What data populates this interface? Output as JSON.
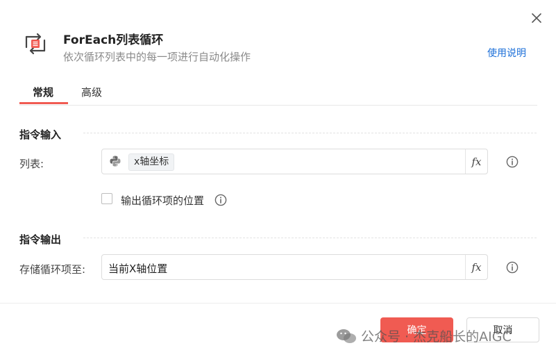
{
  "header": {
    "title": "ForEach列表循环",
    "subtitle": "依次循环列表中的每一项进行自动化操作",
    "help_link": "使用说明"
  },
  "tabs": [
    {
      "label": "常规",
      "active": true
    },
    {
      "label": "高级",
      "active": false
    }
  ],
  "input_section": {
    "title": "指令输入",
    "list_field": {
      "label": "列表:",
      "value_chip": "x轴坐标",
      "fx_label": "fx"
    },
    "output_index_checkbox": {
      "label": "输出循环项的位置",
      "checked": false
    }
  },
  "output_section": {
    "title": "指令输出",
    "store_field": {
      "label": "存储循环项至:",
      "value": "当前X轴位置",
      "fx_label": "fx"
    }
  },
  "footer": {
    "confirm_label": "确定",
    "cancel_label": "取消"
  },
  "watermark": {
    "text": "公众号 · 杰克船长的AIGC"
  },
  "colors": {
    "accent": "#f05b52",
    "link": "#1a6ed8"
  }
}
